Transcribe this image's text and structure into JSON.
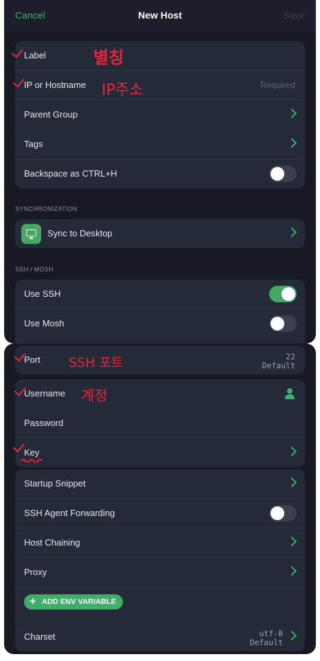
{
  "nav": {
    "cancel": "Cancel",
    "title": "New Host",
    "save": "Save"
  },
  "general": {
    "label": "Label",
    "host": "IP or Hostname",
    "host_placeholder": "Required",
    "parent_group": "Parent Group",
    "tags": "Tags",
    "backspace": "Backspace as CTRL+H"
  },
  "sync": {
    "header": "SYNCHRONIZATION",
    "label": "Sync to Desktop"
  },
  "ssh": {
    "header": "SSH / MOSH",
    "use_ssh": "Use SSH",
    "use_mosh": "Use Mosh",
    "use_ssh_on": true,
    "use_mosh_on": false
  },
  "port": {
    "label": "Port",
    "value": "22",
    "default": "Default"
  },
  "auth": {
    "username": "Username",
    "password": "Password",
    "key": "Key"
  },
  "advanced": {
    "startup_snippet": "Startup Snippet",
    "agent_forwarding": "SSH Agent Forwarding",
    "host_chaining": "Host Chaining",
    "proxy": "Proxy",
    "add_env": "ADD ENV VARIABLE",
    "charset": "Charset",
    "charset_value": "utf-8",
    "charset_default": "Default"
  },
  "annotations": {
    "label_note": "별칭",
    "host_note": "IP주소",
    "port_note": "SSH 포트",
    "username_note": "계정"
  },
  "colors": {
    "accent": "#3fae69",
    "annotation": "#e4283a",
    "background": "#171a25"
  }
}
